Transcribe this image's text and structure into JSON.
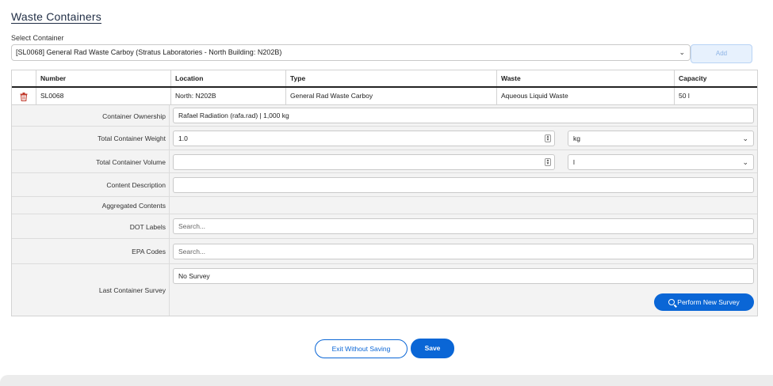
{
  "page": {
    "title": "Waste Containers",
    "select_label": "Select Container",
    "select_value": "[SL0068] General Rad Waste Carboy (Stratus Laboratories - North Building: N202B)",
    "add_label": "Add"
  },
  "table": {
    "headers": [
      "Number",
      "Location",
      "Type",
      "Waste",
      "Capacity"
    ],
    "row": {
      "number": "SL0068",
      "location": "North: N202B",
      "type": "General Rad Waste Carboy",
      "waste": "Aqueous Liquid Waste",
      "capacity": "50 l"
    }
  },
  "form": {
    "ownership_label": "Container Ownership",
    "ownership_value": "Rafael Radiation (rafa.rad) | 1,000 kg",
    "weight_label": "Total Container Weight",
    "weight_value": "1.0",
    "weight_unit": "kg",
    "volume_label": "Total Container Volume",
    "volume_value": "",
    "volume_unit": "l",
    "content_label": "Content Description",
    "content_value": "",
    "aggregated_label": "Aggregated Contents",
    "dot_label": "DOT Labels",
    "dot_placeholder": "Search...",
    "epa_label": "EPA Codes",
    "epa_placeholder": "Search...",
    "survey_label": "Last Container Survey",
    "survey_value": "No Survey",
    "survey_button": "Perform New Survey"
  },
  "actions": {
    "exit_label": "Exit Without Saving",
    "save_label": "Save"
  },
  "icons": {
    "delete": "trash-icon",
    "dropdown": "chevron-down-icon",
    "spinner": "spinner-icon",
    "search": "search-icon"
  },
  "colors": {
    "primary": "#0a66d6",
    "trash": "#c0392b",
    "add_disabled_bg": "#e7f1fd"
  }
}
